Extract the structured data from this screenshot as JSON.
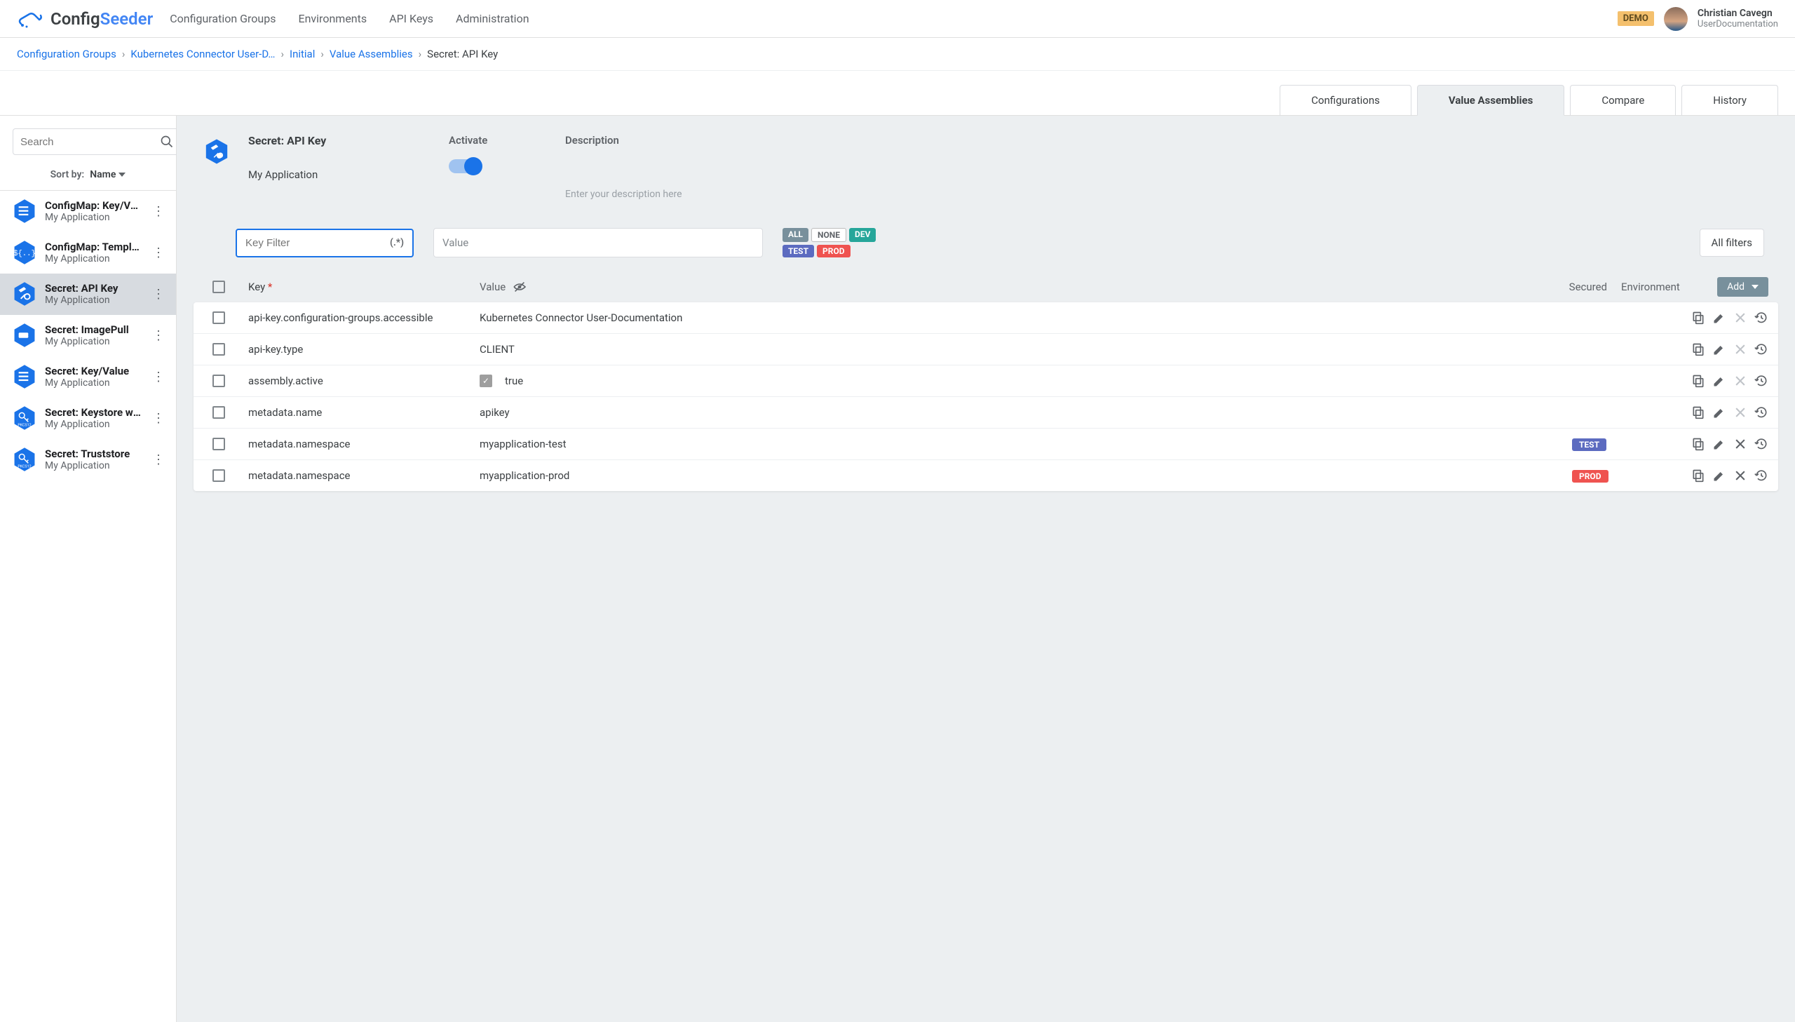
{
  "header": {
    "brand_config": "Config",
    "brand_seeder": "Seeder",
    "nav": [
      "Configuration Groups",
      "Environments",
      "API Keys",
      "Administration"
    ],
    "demo": "DEMO",
    "user_name": "Christian Cavegn",
    "user_sub": "UserDocumentation"
  },
  "breadcrumb": {
    "items": [
      "Configuration Groups",
      "Kubernetes Connector User-D…",
      "Initial",
      "Value Assemblies"
    ],
    "current": "Secret: API Key"
  },
  "tabs": {
    "items": [
      "Configurations",
      "Value Assemblies",
      "Compare",
      "History"
    ],
    "active": 1
  },
  "sidebar": {
    "search_placeholder": "Search",
    "sort_label": "Sort by:",
    "sort_value": "Name",
    "items": [
      {
        "title": "ConfigMap: Key/Va…",
        "sub": "My Application",
        "icon": "list",
        "color": "#1a73e8"
      },
      {
        "title": "ConfigMap: Templ…",
        "sub": "My Application",
        "icon": "template",
        "color": "#1a73e8"
      },
      {
        "title": "Secret: API Key",
        "sub": "My Application",
        "icon": "key",
        "color": "#1a73e8",
        "selected": true
      },
      {
        "title": "Secret: ImagePull",
        "sub": "My Application",
        "icon": "pull",
        "color": "#1a73e8"
      },
      {
        "title": "Secret: Key/Value",
        "sub": "My Application",
        "icon": "list",
        "color": "#1a73e8"
      },
      {
        "title": "Secret: Keystore wi…",
        "sub": "My Application",
        "icon": "pkcs",
        "color": "#1a73e8"
      },
      {
        "title": "Secret: Truststore",
        "sub": "My Application",
        "icon": "pkcs",
        "color": "#1a73e8"
      }
    ]
  },
  "main": {
    "title": "Secret: API Key",
    "subtitle": "My Application",
    "activate_label": "Activate",
    "description_label": "Description",
    "description_placeholder": "Enter your description here",
    "filters": {
      "key_placeholder": "Key Filter",
      "regex": "(.*)",
      "value_placeholder": "Value",
      "env_pills": [
        {
          "label": "ALL",
          "class": "pill-all"
        },
        {
          "label": "NONE",
          "class": "pill-none"
        },
        {
          "label": "DEV",
          "class": "pill-dev"
        },
        {
          "label": "TEST",
          "class": "pill-test"
        },
        {
          "label": "PROD",
          "class": "pill-prod"
        }
      ],
      "all_filters": "All filters"
    },
    "table": {
      "head": {
        "key": "Key",
        "value": "Value",
        "secured": "Secured",
        "environment": "Environment",
        "add": "Add"
      },
      "rows": [
        {
          "key": "api-key.configuration-groups.accessible",
          "value": "Kubernetes Connector User-Documentation",
          "env": "",
          "deletable": false
        },
        {
          "key": "api-key.type",
          "value": "CLIENT",
          "env": "",
          "deletable": false
        },
        {
          "key": "assembly.active",
          "value": "true",
          "checkbox": true,
          "env": "",
          "deletable": false
        },
        {
          "key": "metadata.name",
          "value": "apikey",
          "env": "",
          "deletable": false
        },
        {
          "key": "metadata.namespace",
          "value": "myapplication-test",
          "env": "TEST",
          "env_class": "pill-test",
          "deletable": true
        },
        {
          "key": "metadata.namespace",
          "value": "myapplication-prod",
          "env": "PROD",
          "env_class": "pill-prod",
          "deletable": true
        }
      ]
    }
  }
}
